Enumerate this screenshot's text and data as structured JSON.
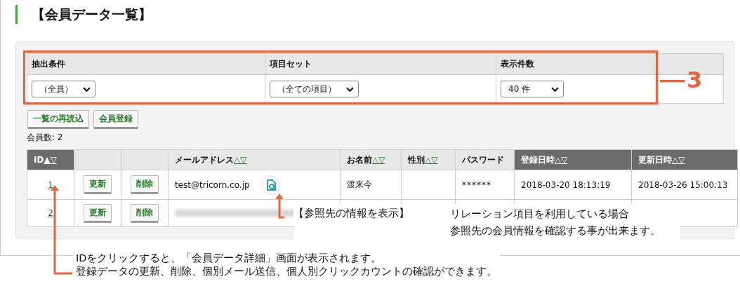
{
  "title": "【会員データ一覧】",
  "filters": [
    {
      "label": "抽出条件",
      "value": "（全員）"
    },
    {
      "label": "項目セット",
      "value": "（全ての項目）"
    },
    {
      "label": "表示件数",
      "value": "40 件"
    }
  ],
  "buttons": [
    "一覧の再読込",
    "会員登録"
  ],
  "member_count": "会員数: 2",
  "table": {
    "columns": [
      {
        "label": "ID",
        "sort": "▲▽",
        "highlighted": true
      },
      {
        "highlighted": false
      },
      {
        "highlighted": false
      },
      {
        "label": "メールアドレス",
        "sort": "△▽",
        "highlighted": false
      },
      {
        "label": "お名前",
        "sort": "△▽",
        "highlighted": false
      },
      {
        "label": "性別",
        "sort": "△▽",
        "highlighted": false
      },
      {
        "label": "パスワード",
        "highlighted": false
      },
      {
        "label": "登録日時",
        "sort": "△▽",
        "highlighted": true
      },
      {
        "label": "更新日時",
        "sort": "△▽",
        "highlighted": true
      }
    ],
    "rows": [
      {
        "id": "1",
        "update": "更新",
        "delete": "削除",
        "email": "test@tricorn.co.jp",
        "email_blurred": false,
        "name": "渡来今",
        "password": "******",
        "registered": "2018-03-20 18:13:19",
        "updated": "2018-03-26 15:00:13"
      },
      {
        "id": "2",
        "update": "更新",
        "delete": "削除",
        "email_blurred": true
      }
    ]
  },
  "annotations": {
    "section_number": "3",
    "reference_label": "【参照先の情報を表示】",
    "reference_note": [
      "リレーション項目を利用している場合",
      "参照先の会員情報を確認する事が出来ます。"
    ],
    "id_note": [
      "IDをクリックすると、「会員データ詳細」画面が表示されます。",
      "登録データの更新、削除、個別メール送信、個人別クリックカウントの確認ができます。"
    ]
  }
}
